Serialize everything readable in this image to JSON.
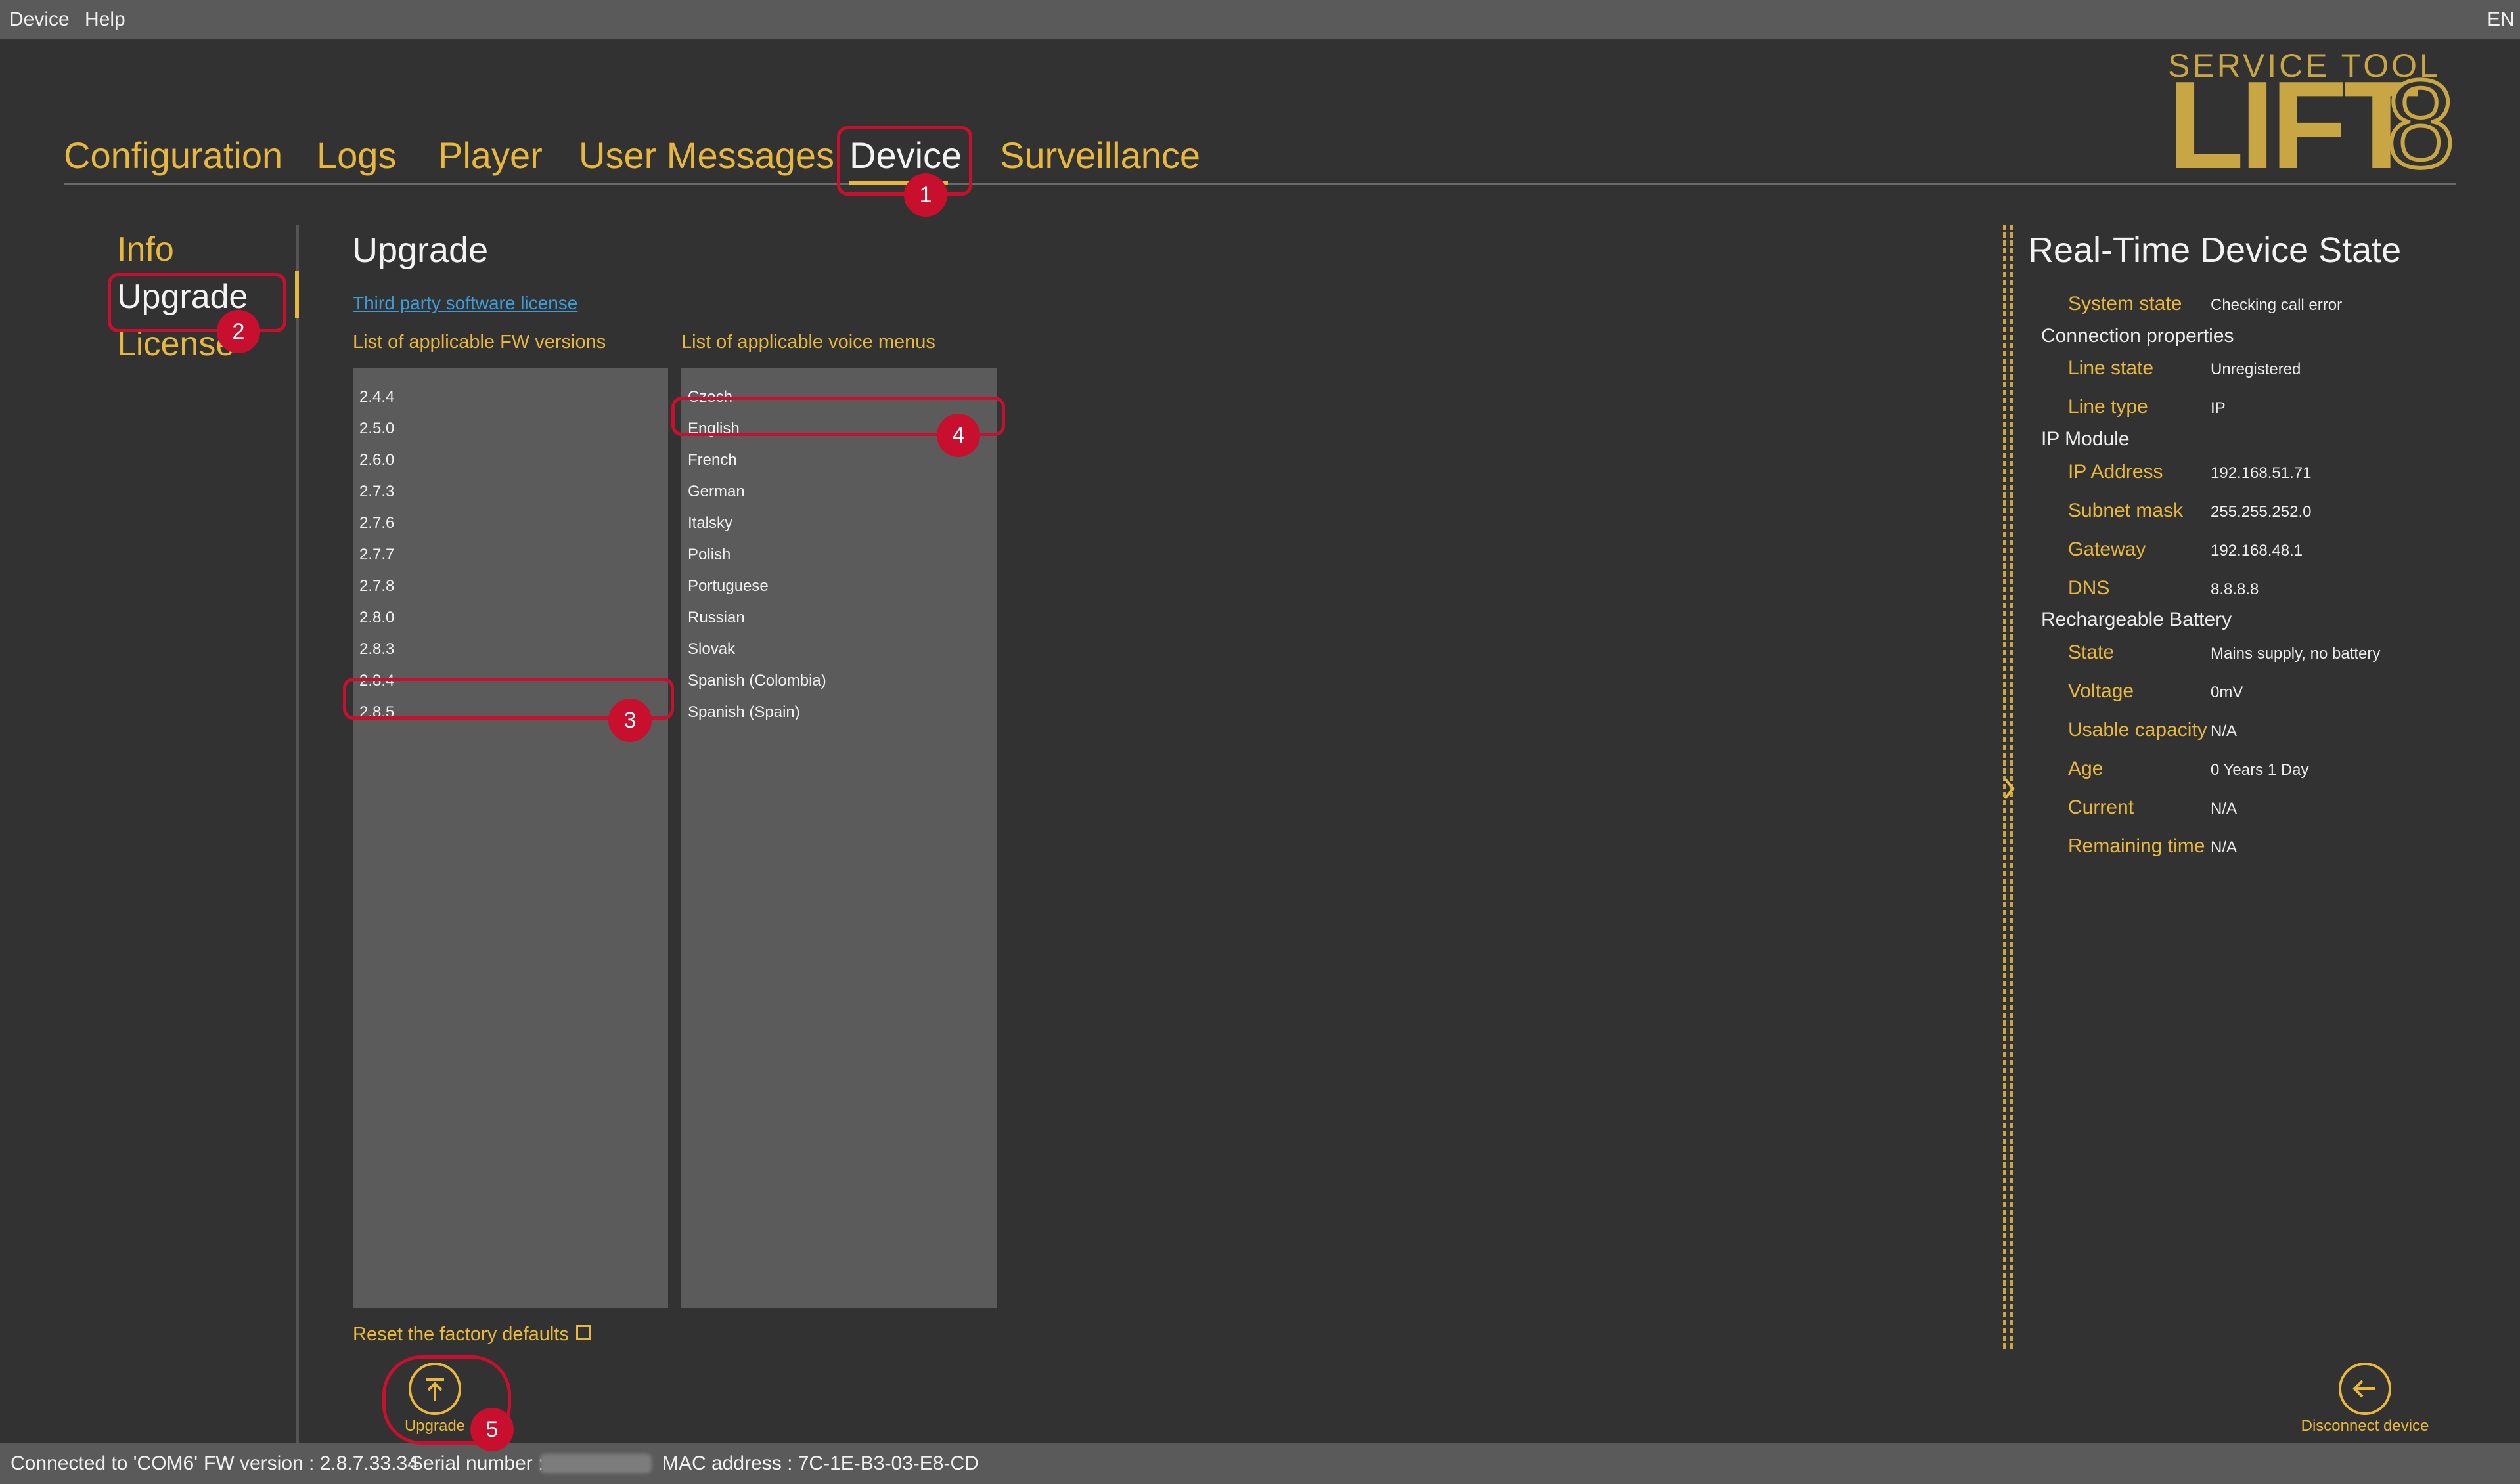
{
  "menubar": {
    "device": "Device",
    "help": "Help",
    "language": "EN"
  },
  "tabs": [
    {
      "label": "Configuration"
    },
    {
      "label": "Logs"
    },
    {
      "label": "Player"
    },
    {
      "label": "User Messages"
    },
    {
      "label": "Device",
      "active": true
    },
    {
      "label": "Surveillance"
    }
  ],
  "logo": {
    "top": "SERVICE TOOL",
    "main": "LIFT",
    "digit": "8"
  },
  "sidebar": {
    "items": [
      {
        "label": "Info"
      },
      {
        "label": "Upgrade",
        "active": true
      },
      {
        "label": "License"
      }
    ]
  },
  "main": {
    "title": "Upgrade",
    "license_link": "Third party software license",
    "fw_list_title": "List of applicable FW versions",
    "voice_list_title": "List of applicable voice menus",
    "fw_versions": [
      "2.4.4",
      "2.5.0",
      "2.6.0",
      "2.7.3",
      "2.7.6",
      "2.7.7",
      "2.7.8",
      "2.8.0",
      "2.8.3",
      "2.8.4",
      "2.8.5"
    ],
    "fw_selected": "2.8.5",
    "voice_menus": [
      "Czech",
      "English",
      "French",
      "German",
      "Italsky",
      "Polish",
      "Portuguese",
      "Russian",
      "Slovak",
      "Spanish (Colombia)",
      "Spanish (Spain)"
    ],
    "voice_selected": "English",
    "reset_label": "Reset the factory defaults",
    "reset_checked": false,
    "upgrade_button": "Upgrade",
    "disconnect_button": "Disconnect device"
  },
  "state_panel": {
    "title": "Real-Time Device State",
    "system_state_label": "System state",
    "system_state_value": "Checking call error",
    "connection_group": "Connection properties",
    "line_state_label": "Line state",
    "line_state_value": "Unregistered",
    "line_type_label": "Line type",
    "line_type_value": "IP",
    "ip_group": "IP Module",
    "ip_address_label": "IP Address",
    "ip_address_value": "192.168.51.71",
    "subnet_label": "Subnet mask",
    "subnet_value": "255.255.252.0",
    "gateway_label": "Gateway",
    "gateway_value": "192.168.48.1",
    "dns_label": "DNS",
    "dns_value": "8.8.8.8",
    "battery_group": "Rechargeable Battery",
    "bat_state_label": "State",
    "bat_state_value": "Mains supply, no battery",
    "voltage_label": "Voltage",
    "voltage_value": "0mV",
    "capacity_label": "Usable capacity",
    "capacity_value": "N/A",
    "age_label": "Age",
    "age_value": "0 Years 1 Day",
    "current_label": "Current",
    "current_value": "N/A",
    "remaining_label": "Remaining time",
    "remaining_value": "N/A"
  },
  "statusbar": {
    "connected": "Connected to 'COM6'",
    "fw_version": "FW version : 2.8.7.33.34",
    "serial": "Serial number :",
    "mac": "MAC address : 7C-1E-B3-03-E8-CD"
  },
  "annotations": [
    "1",
    "2",
    "3",
    "4",
    "5"
  ],
  "colors": {
    "accent": "#e8b83e",
    "annotation": "#c8102e",
    "background": "#323232"
  }
}
